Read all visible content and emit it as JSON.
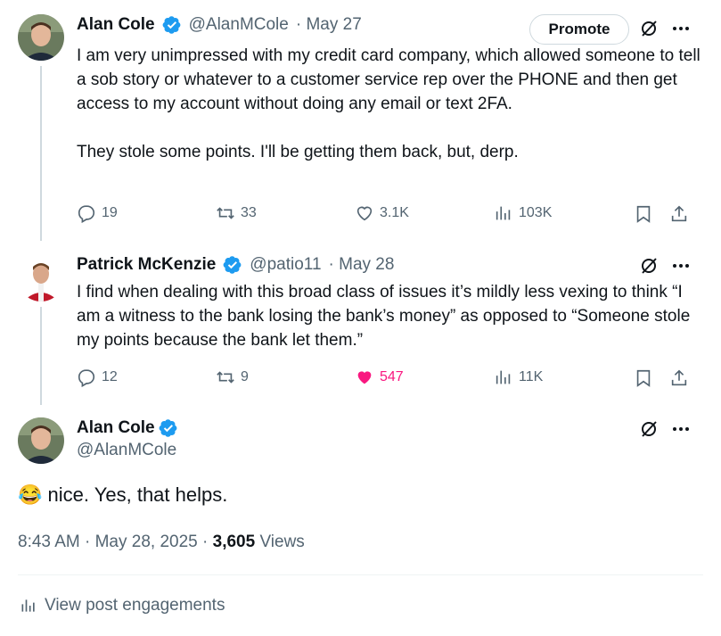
{
  "tweet1": {
    "name": "Alan Cole",
    "handle": "@AlanMCole",
    "date": "· May 27",
    "promote_label": "Promote",
    "text": "I am very unimpressed with my credit card company, which allowed someone to tell a sob story or whatever to a customer service rep over the PHONE and then get access to my account without doing any email or text 2FA.\n\nThey stole some points. I'll be getting them back, but, derp.",
    "replies": "19",
    "reposts": "33",
    "likes": "3.1K",
    "views": "103K"
  },
  "tweet2": {
    "name": "Patrick McKenzie",
    "handle": "@patio11",
    "date": "· May 28",
    "text": "I find when dealing with this broad class of issues it’s mildly less vexing to think “I am a witness to the bank losing the bank’s money” as opposed to “Someone stole my points because the bank let them.”",
    "replies": "12",
    "reposts": "9",
    "likes": "547",
    "views": "11K"
  },
  "main": {
    "name": "Alan Cole",
    "handle": "@AlanMCole",
    "emoji": "😂",
    "text": "nice. Yes, that helps.",
    "timestamp": "8:43 AM · May 28, 2025 · ",
    "view_count": "3,605",
    "views_label": " Views",
    "engagements_label": "View post engagements"
  },
  "colors": {
    "verified": "#1d9bf0",
    "like_active": "#f91880",
    "secondary": "#536471"
  }
}
